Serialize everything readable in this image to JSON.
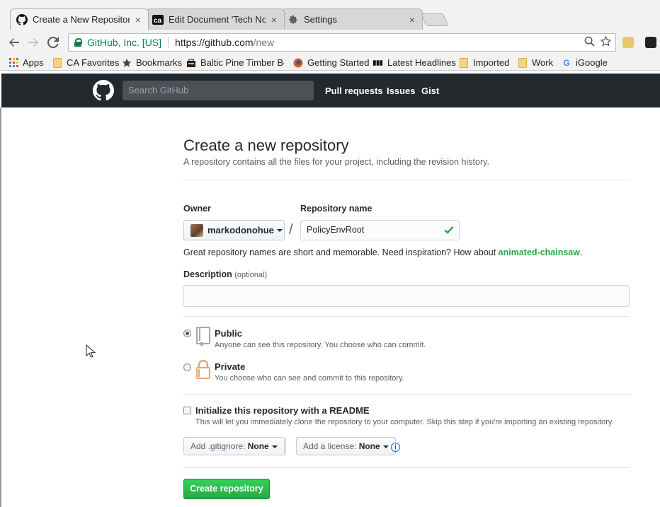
{
  "browser": {
    "tabs": [
      {
        "label": "Create a New Repository",
        "icon": "github-icon",
        "close": "×",
        "active": true
      },
      {
        "label": "Edit Document 'Tech Not",
        "icon": "ca-icon",
        "close": "×",
        "active": false
      },
      {
        "label": "Settings",
        "icon": "gear-icon",
        "close": "×",
        "active": false
      }
    ],
    "omnibox": {
      "security_label": "GitHub, Inc. [US]",
      "url_scheme_host": "https://github.com",
      "url_path": "/new"
    },
    "bookmarks": [
      {
        "label": "Apps",
        "icon": "apps-grid-icon"
      },
      {
        "label": "CA Favorites",
        "icon": "folder-icon"
      },
      {
        "label": "Bookmarks",
        "icon": "star-icon"
      },
      {
        "label": "Baltic Pine Timber Boo",
        "icon": "bag-icon"
      },
      {
        "label": "Getting Started",
        "icon": "firefox-icon"
      },
      {
        "label": "Latest Headlines",
        "icon": "bbc-icon"
      },
      {
        "label": "Imported",
        "icon": "folder-icon"
      },
      {
        "label": "Work",
        "icon": "folder-icon"
      },
      {
        "label": "iGoogle",
        "icon": "google-icon"
      }
    ]
  },
  "github_header": {
    "search_placeholder": "Search GitHub",
    "nav": [
      "Pull requests",
      "Issues",
      "Gist"
    ]
  },
  "form": {
    "title": "Create a new repository",
    "subtitle": "A repository contains all the files for your project, including the revision history.",
    "owner_label": "Owner",
    "owner_value": "markodonohue",
    "separator": "/",
    "repo_label": "Repository name",
    "repo_value": "PolicyEnvRoot",
    "hint_prefix": "Great repository names are short and memorable. Need inspiration? How about ",
    "hint_suggestion": "animated-chainsaw",
    "hint_suffix": ".",
    "description_label": "Description",
    "description_optional": "(optional)",
    "description_value": "",
    "visibility": [
      {
        "title": "Public",
        "note": "Anyone can see this repository. You choose who can commit.",
        "selected": true,
        "icon": "repo-book-icon"
      },
      {
        "title": "Private",
        "note": "You choose who can see and commit to this repository.",
        "selected": false,
        "icon": "lock-icon"
      }
    ],
    "readme_label": "Initialize this repository with a README",
    "readme_note": "This will let you immediately clone the repository to your computer. Skip this step if you're importing an existing repository.",
    "readme_checked": false,
    "gitignore_prefix": "Add .gitignore: ",
    "gitignore_value": "None",
    "license_prefix": "Add a license: ",
    "license_value": "None",
    "info_glyph": "i",
    "submit_label": "Create repository"
  },
  "colors": {
    "header_bg": "#24292e",
    "primary_green": "#28a745",
    "link_blue": "#0366d6",
    "secure_green": "#0b8043"
  }
}
